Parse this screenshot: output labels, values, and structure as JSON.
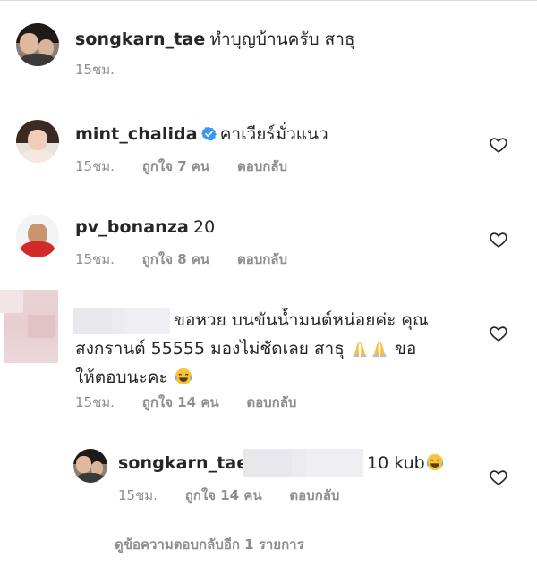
{
  "comments": [
    {
      "username": "songkarn_tae",
      "text": "ทำบุญบ้านครับ สาธุ",
      "time": "15ชม."
    },
    {
      "username": "mint_chalida",
      "verified": true,
      "text": "คาเวียร์มั่วแนว",
      "time": "15ชม.",
      "likes": "ถูกใจ 7 คน",
      "reply_label": "ตอบกลับ"
    },
    {
      "username": "pv_bonanza",
      "text": "20",
      "time": "15ชม.",
      "likes": "ถูกใจ 8 คน",
      "reply_label": "ตอบกลับ"
    },
    {
      "username_hidden": true,
      "text_line1": "ขอหวย บนขันน้ำมนต์หน่อยค่ะ คุณ",
      "text_line2": "สงกรานต์ 55555 มองไม่ชัดเลย สาธุ",
      "text_line2_end": "ขอ",
      "text_line3": "ให้ตอบนะคะ",
      "time": "15ชม.",
      "likes": "ถูกใจ 14 คน",
      "reply_label": "ตอบกลับ"
    }
  ],
  "reply": {
    "username": "songkarn_tae",
    "text": "10 kub",
    "time": "15ชม.",
    "likes": "ถูกใจ 14 คน",
    "reply_label": "ตอบกลับ"
  },
  "view_more_replies": "ดูข้อความตอบกลับอีก 1 รายการ",
  "icons": {
    "like": "heart-outline-icon",
    "verified": "verified-badge-icon",
    "pray": "folded-hands-emoji",
    "laugh": "tears-of-joy-emoji"
  },
  "colors": {
    "text": "#262626",
    "meta": "#8e8e8e",
    "verified": "#3897f0"
  }
}
